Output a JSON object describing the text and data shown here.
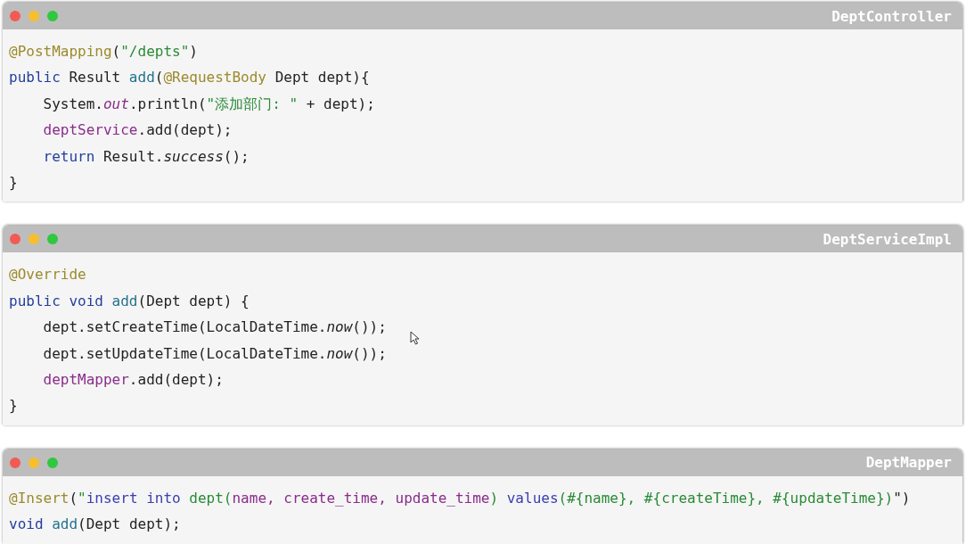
{
  "cards": [
    {
      "title": "DeptController",
      "lines": [
        [
          {
            "kind": "annotation",
            "text": "@PostMapping"
          },
          {
            "kind": "plain",
            "text": "("
          },
          {
            "kind": "string",
            "text": "\"/depts\""
          },
          {
            "kind": "plain",
            "text": ")"
          }
        ],
        [
          {
            "kind": "keyword",
            "text": "public"
          },
          {
            "kind": "plain",
            "text": " Result "
          },
          {
            "kind": "method",
            "text": "add"
          },
          {
            "kind": "plain",
            "text": "("
          },
          {
            "kind": "annotation",
            "text": "@RequestBody"
          },
          {
            "kind": "plain",
            "text": " Dept dept){"
          }
        ],
        [
          {
            "kind": "plain",
            "text": "    System."
          },
          {
            "kind": "static_italic",
            "text": "out"
          },
          {
            "kind": "plain",
            "text": ".println("
          },
          {
            "kind": "string",
            "text": "\"添加部门: \""
          },
          {
            "kind": "plain",
            "text": " + dept);"
          }
        ],
        [
          {
            "kind": "field",
            "text": "    deptService"
          },
          {
            "kind": "plain",
            "text": ".add(dept);"
          }
        ],
        [
          {
            "kind": "keyword",
            "text": "    return"
          },
          {
            "kind": "plain",
            "text": " Result."
          },
          {
            "kind": "italic",
            "text": "success"
          },
          {
            "kind": "plain",
            "text": "();"
          }
        ],
        [
          {
            "kind": "plain",
            "text": "}"
          }
        ]
      ]
    },
    {
      "title": "DeptServiceImpl",
      "lines": [
        [
          {
            "kind": "annotation",
            "text": "@Override"
          }
        ],
        [
          {
            "kind": "keyword",
            "text": "public void "
          },
          {
            "kind": "method",
            "text": "add"
          },
          {
            "kind": "plain",
            "text": "(Dept dept) {"
          }
        ],
        [
          {
            "kind": "plain",
            "text": "    dept.setCreateTime(LocalDateTime."
          },
          {
            "kind": "italic",
            "text": "now"
          },
          {
            "kind": "plain",
            "text": "());"
          }
        ],
        [
          {
            "kind": "plain",
            "text": "    dept.setUpdateTime(LocalDateTime."
          },
          {
            "kind": "italic",
            "text": "now"
          },
          {
            "kind": "plain",
            "text": "());"
          }
        ],
        [
          {
            "kind": "field",
            "text": "    deptMapper"
          },
          {
            "kind": "plain",
            "text": ".add(dept);"
          }
        ],
        [
          {
            "kind": "plain",
            "text": "}"
          }
        ]
      ]
    },
    {
      "title": "DeptMapper",
      "lines": [
        [
          {
            "kind": "annotation",
            "text": "@Insert"
          },
          {
            "kind": "plain",
            "text": "("
          },
          {
            "kind": "string",
            "text": "\""
          },
          {
            "kind": "sql_keyword",
            "text": "insert into"
          },
          {
            "kind": "string",
            "text": " dept("
          },
          {
            "kind": "field",
            "text": "name, create_time, update_time"
          },
          {
            "kind": "string",
            "text": ") "
          },
          {
            "kind": "sql_keyword",
            "text": "values"
          },
          {
            "kind": "string",
            "text": "(#{name}, #{createTime}, #{updateTime})"
          },
          {
            "kind": "plain",
            "text": "\")"
          }
        ],
        [
          {
            "kind": "keyword",
            "text": "void "
          },
          {
            "kind": "method",
            "text": "add"
          },
          {
            "kind": "plain",
            "text": "(Dept dept);"
          }
        ]
      ]
    }
  ]
}
